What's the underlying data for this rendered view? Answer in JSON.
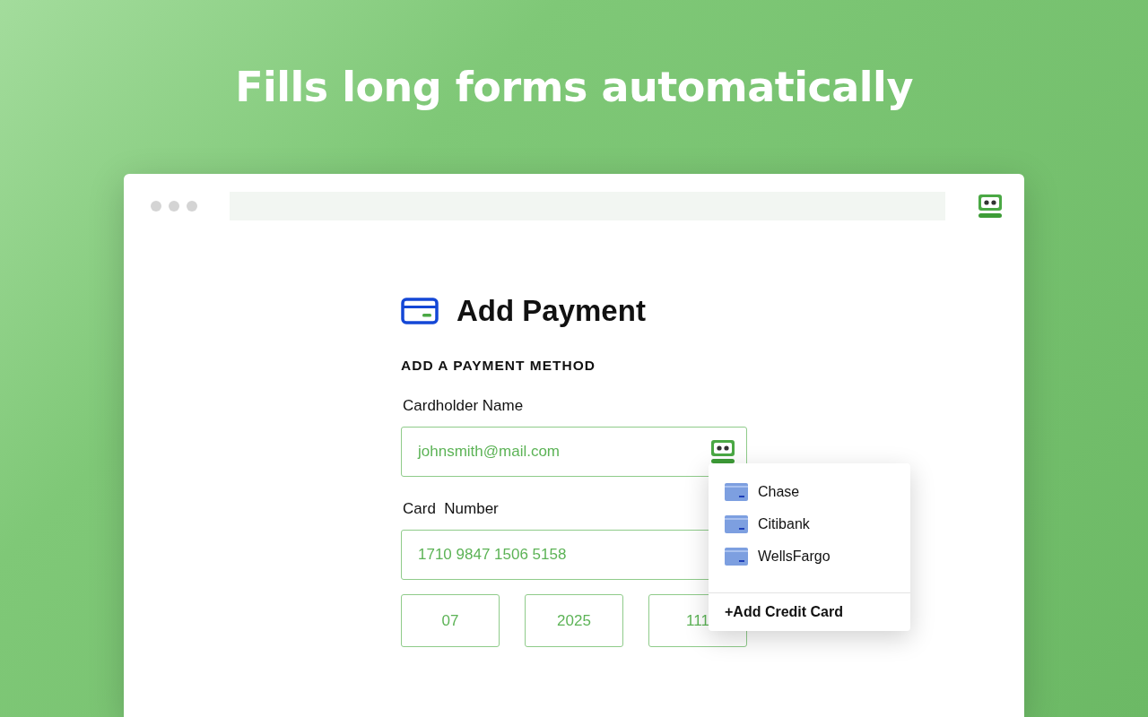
{
  "headline": "Fills long forms automatically",
  "form": {
    "title": "Add Payment",
    "section": "ADD A PAYMENT METHOD",
    "fields": [
      {
        "kind": "autofill",
        "label": "Cardholder Name",
        "value": "johnsmith@mail.com"
      },
      {
        "kind": "plain",
        "label": "Card  Number",
        "value": "1710 9847 1506 5158"
      }
    ],
    "short_fields": [
      "07",
      "2025",
      "111"
    ]
  },
  "dropdown": {
    "items": [
      {
        "name": "Chase"
      },
      {
        "name": "Citibank"
      },
      {
        "name": "WellsFargo"
      }
    ],
    "add_action": "+Add Credit Card"
  }
}
